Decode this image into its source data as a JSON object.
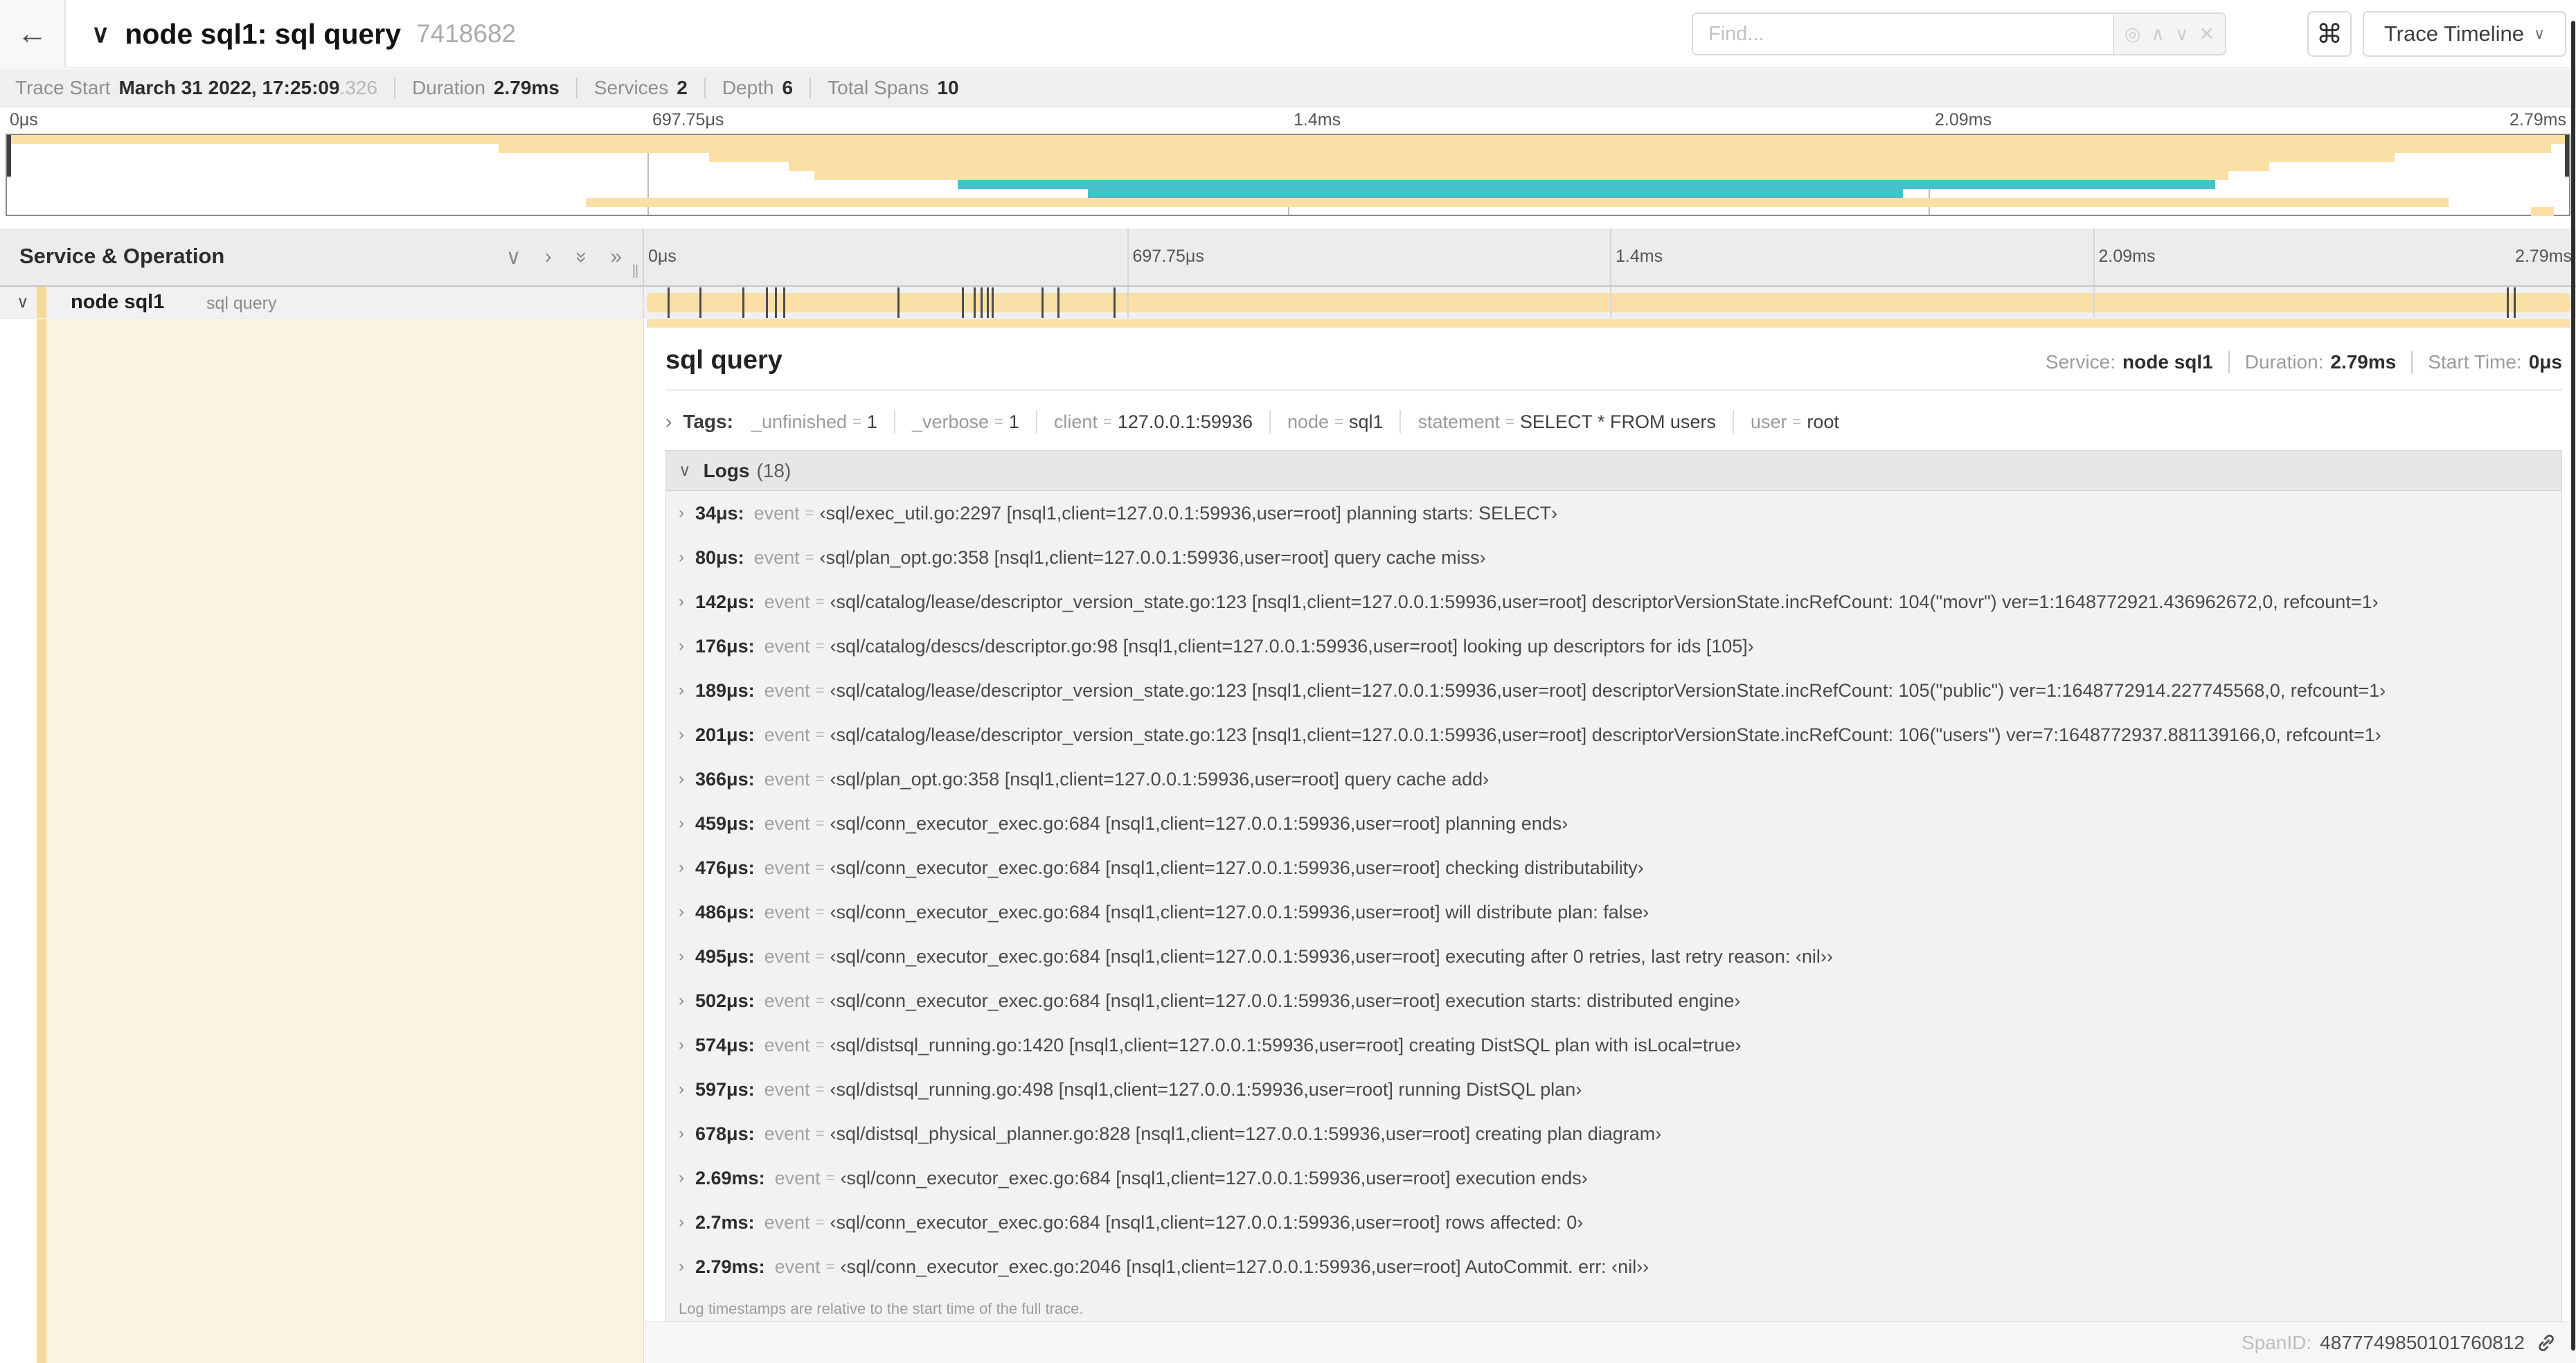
{
  "icons": {
    "back": "←",
    "chevron_down": "∨",
    "chevron_right": "›",
    "double_right": "»",
    "locate": "◎",
    "up": "∧",
    "down": "∨",
    "clear": "✕",
    "eq": "="
  },
  "header": {
    "title": "node sql1: sql query",
    "trace_id": "7418682",
    "find_placeholder": "Find...",
    "shortcut_key": "⌘",
    "view_selector": "Trace Timeline"
  },
  "summary": {
    "items": [
      {
        "label": "Trace Start",
        "value": "March 31 2022, 17:25:09",
        "muted": ".326"
      },
      {
        "label": "Duration",
        "value": "2.79ms"
      },
      {
        "label": "Services",
        "value": "2"
      },
      {
        "label": "Depth",
        "value": "6"
      },
      {
        "label": "Total Spans",
        "value": "10"
      }
    ]
  },
  "timeline": {
    "ticks": [
      "0μs",
      "697.75μs",
      "1.4ms",
      "2.09ms",
      "2.79ms"
    ],
    "duration_us": 2790,
    "column_header": "Service & Operation"
  },
  "minimap": {
    "colors": {
      "tan": "#FADFA6",
      "teal": "#45C2C8"
    },
    "bars": [
      {
        "row": 0,
        "left": 0,
        "width": 100,
        "color": "tan"
      },
      {
        "row": 1,
        "left": 19.2,
        "width": 80.1,
        "color": "tan"
      },
      {
        "row": 2,
        "left": 27.4,
        "width": 65.8,
        "color": "tan"
      },
      {
        "row": 3,
        "left": 30.5,
        "width": 57.8,
        "color": "tan"
      },
      {
        "row": 4,
        "left": 31.5,
        "width": 55.2,
        "color": "tan"
      },
      {
        "row": 5,
        "left": 37.1,
        "width": 49.1,
        "color": "teal"
      },
      {
        "row": 6,
        "left": 42.2,
        "width": 31.8,
        "color": "teal"
      },
      {
        "row": 7,
        "left": 22.6,
        "width": 72.7,
        "color": "tan"
      },
      {
        "row": 8,
        "left": 98.5,
        "width": 0.9,
        "color": "tan"
      }
    ]
  },
  "span_row": {
    "service": "node sql1",
    "operation": "sql query"
  },
  "detail": {
    "title": "sql query",
    "meta": [
      {
        "label": "Service:",
        "value": "node sql1"
      },
      {
        "label": "Duration:",
        "value": "2.79ms"
      },
      {
        "label": "Start Time:",
        "value": "0μs"
      }
    ],
    "tags": {
      "label": "Tags:",
      "items": [
        {
          "key": "_unfinished",
          "value": "1"
        },
        {
          "key": "_verbose",
          "value": "1"
        },
        {
          "key": "client",
          "value": "127.0.0.1:59936"
        },
        {
          "key": "node",
          "value": "sql1"
        },
        {
          "key": "statement",
          "value": "SELECT * FROM users"
        },
        {
          "key": "user",
          "value": "root"
        }
      ]
    },
    "logs": {
      "label": "Logs",
      "count": "(18)",
      "note": "Log timestamps are relative to the start time of the full trace.",
      "entries": [
        {
          "t_us": 34,
          "time": "34μs:",
          "key": "event",
          "value": "‹sql/exec_util.go:2297 [nsql1,client=127.0.0.1:59936,user=root] planning starts: SELECT›"
        },
        {
          "t_us": 80,
          "time": "80μs:",
          "key": "event",
          "value": "‹sql/plan_opt.go:358 [nsql1,client=127.0.0.1:59936,user=root] query cache miss›"
        },
        {
          "t_us": 142,
          "time": "142μs:",
          "key": "event",
          "value": "‹sql/catalog/lease/descriptor_version_state.go:123 [nsql1,client=127.0.0.1:59936,user=root] descriptorVersionState.incRefCount: 104(\"movr\") ver=1:1648772921.436962672,0, refcount=1›"
        },
        {
          "t_us": 176,
          "time": "176μs:",
          "key": "event",
          "value": "‹sql/catalog/descs/descriptor.go:98 [nsql1,client=127.0.0.1:59936,user=root] looking up descriptors for ids [105]›"
        },
        {
          "t_us": 189,
          "time": "189μs:",
          "key": "event",
          "value": "‹sql/catalog/lease/descriptor_version_state.go:123 [nsql1,client=127.0.0.1:59936,user=root] descriptorVersionState.incRefCount: 105(\"public\") ver=1:1648772914.227745568,0, refcount=1›"
        },
        {
          "t_us": 201,
          "time": "201μs:",
          "key": "event",
          "value": "‹sql/catalog/lease/descriptor_version_state.go:123 [nsql1,client=127.0.0.1:59936,user=root] descriptorVersionState.incRefCount: 106(\"users\") ver=7:1648772937.881139166,0, refcount=1›"
        },
        {
          "t_us": 366,
          "time": "366μs:",
          "key": "event",
          "value": "‹sql/plan_opt.go:358 [nsql1,client=127.0.0.1:59936,user=root] query cache add›"
        },
        {
          "t_us": 459,
          "time": "459μs:",
          "key": "event",
          "value": "‹sql/conn_executor_exec.go:684 [nsql1,client=127.0.0.1:59936,user=root] planning ends›"
        },
        {
          "t_us": 476,
          "time": "476μs:",
          "key": "event",
          "value": "‹sql/conn_executor_exec.go:684 [nsql1,client=127.0.0.1:59936,user=root] checking distributability›"
        },
        {
          "t_us": 486,
          "time": "486μs:",
          "key": "event",
          "value": "‹sql/conn_executor_exec.go:684 [nsql1,client=127.0.0.1:59936,user=root] will distribute plan: false›"
        },
        {
          "t_us": 495,
          "time": "495μs:",
          "key": "event",
          "value": "‹sql/conn_executor_exec.go:684 [nsql1,client=127.0.0.1:59936,user=root] executing after 0 retries, last retry reason: ‹nil››"
        },
        {
          "t_us": 502,
          "time": "502μs:",
          "key": "event",
          "value": "‹sql/conn_executor_exec.go:684 [nsql1,client=127.0.0.1:59936,user=root] execution starts: distributed engine›"
        },
        {
          "t_us": 574,
          "time": "574μs:",
          "key": "event",
          "value": "‹sql/distsql_running.go:1420 [nsql1,client=127.0.0.1:59936,user=root] creating DistSQL plan with isLocal=true›"
        },
        {
          "t_us": 597,
          "time": "597μs:",
          "key": "event",
          "value": "‹sql/distsql_running.go:498 [nsql1,client=127.0.0.1:59936,user=root] running DistSQL plan›"
        },
        {
          "t_us": 678,
          "time": "678μs:",
          "key": "event",
          "value": "‹sql/distsql_physical_planner.go:828 [nsql1,client=127.0.0.1:59936,user=root] creating plan diagram›"
        },
        {
          "t_us": 2690,
          "time": "2.69ms:",
          "key": "event",
          "value": "‹sql/conn_executor_exec.go:684 [nsql1,client=127.0.0.1:59936,user=root] execution ends›"
        },
        {
          "t_us": 2700,
          "time": "2.7ms:",
          "key": "event",
          "value": "‹sql/conn_executor_exec.go:684 [nsql1,client=127.0.0.1:59936,user=root] rows affected: 0›"
        },
        {
          "t_us": 2790,
          "time": "2.79ms:",
          "key": "event",
          "value": "‹sql/conn_executor_exec.go:2046 [nsql1,client=127.0.0.1:59936,user=root] AutoCommit. err: ‹nil››"
        }
      ]
    },
    "footer": {
      "label": "SpanID:",
      "value": "4877749850101760812"
    }
  }
}
